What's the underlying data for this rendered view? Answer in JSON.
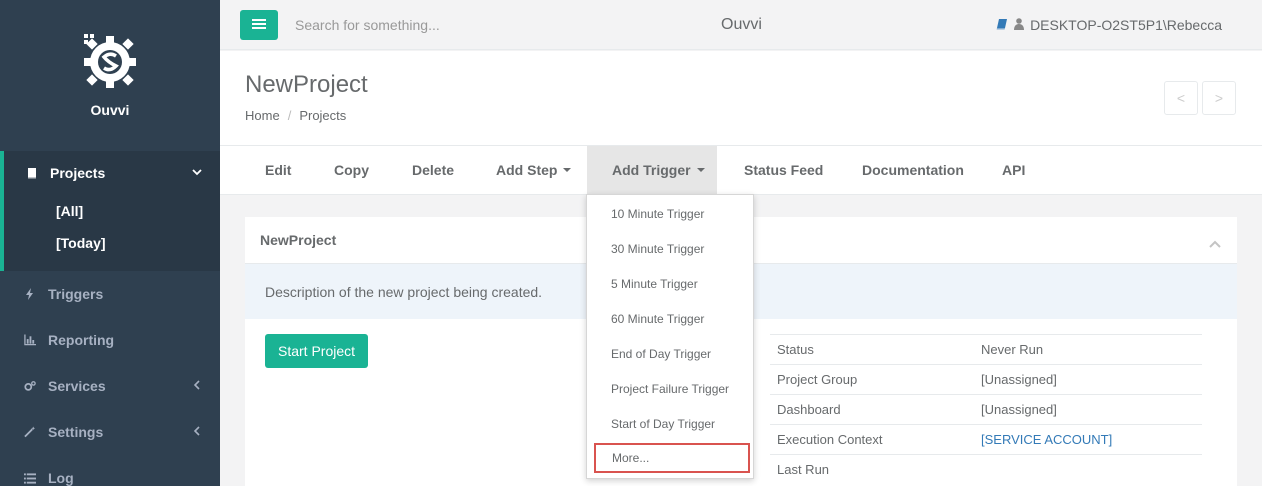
{
  "app": {
    "brand_name": "Ouvvi",
    "title": "Ouvvi"
  },
  "topbar": {
    "search_placeholder": "Search for something...",
    "user": "DESKTOP-O2ST5P1\\Rebecca"
  },
  "sidebar": {
    "projects": {
      "label": "Projects",
      "sub": [
        "[All]",
        "[Today]"
      ]
    },
    "items": [
      {
        "label": "Triggers",
        "icon": "bolt-icon"
      },
      {
        "label": "Reporting",
        "icon": "bar-chart-icon"
      },
      {
        "label": "Services",
        "icon": "cogs-icon"
      },
      {
        "label": "Settings",
        "icon": "magic-wand-icon"
      },
      {
        "label": "Log",
        "icon": "list-icon"
      }
    ]
  },
  "page": {
    "title": "NewProject",
    "breadcrumb": [
      "Home",
      "Projects"
    ],
    "prev": "<",
    "next": ">"
  },
  "tabs": [
    "Edit",
    "Copy",
    "Delete",
    "Add Step",
    "Add Trigger",
    "Status Feed",
    "Documentation",
    "API"
  ],
  "dropdown": [
    "10 Minute Trigger",
    "30 Minute Trigger",
    "5 Minute Trigger",
    "60 Minute Trigger",
    "End of Day Trigger",
    "Project Failure Trigger",
    "Start of Day Trigger",
    "More..."
  ],
  "panel": {
    "title": "NewProject",
    "description": "Description of the new project being created.",
    "start_button": "Start Project",
    "info": [
      {
        "key": "Status",
        "value": "Never Run"
      },
      {
        "key": "Project Group",
        "value": "[Unassigned]"
      },
      {
        "key": "Dashboard",
        "value": "[Unassigned]"
      },
      {
        "key": "Execution Context",
        "value": "[SERVICE ACCOUNT]"
      },
      {
        "key": "Last Run",
        "value": ""
      }
    ]
  },
  "colors": {
    "accent": "#1ab394",
    "sidebar": "#2f4050",
    "highlight_border": "#d9534f",
    "link": "#337ab7"
  }
}
